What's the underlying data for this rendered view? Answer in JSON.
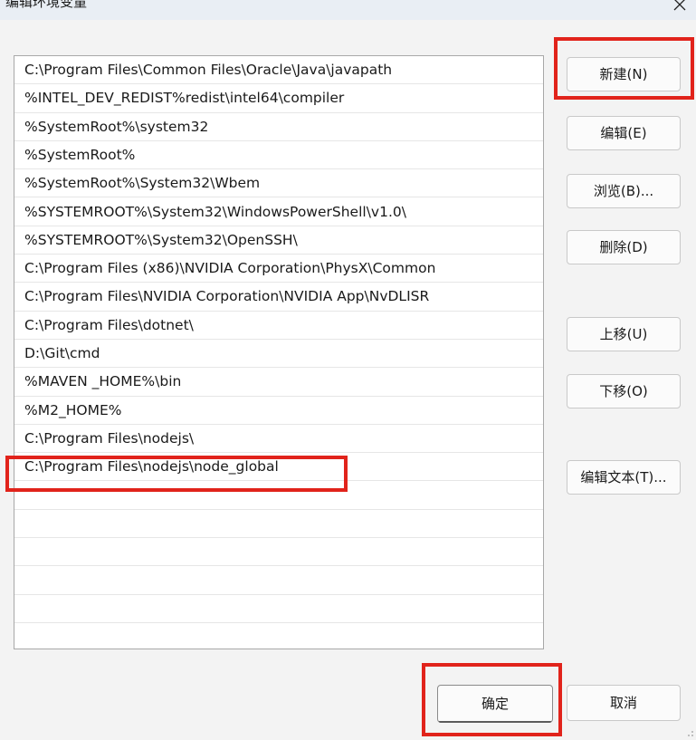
{
  "window": {
    "title": "编辑环境变量",
    "close_icon": "close-icon"
  },
  "path_list": {
    "entries": [
      "C:\\Program Files\\Common Files\\Oracle\\Java\\javapath",
      "%INTEL_DEV_REDIST%redist\\intel64\\compiler",
      "%SystemRoot%\\system32",
      "%SystemRoot%",
      "%SystemRoot%\\System32\\Wbem",
      "%SYSTEMROOT%\\System32\\WindowsPowerShell\\v1.0\\",
      "%SYSTEMROOT%\\System32\\OpenSSH\\",
      "C:\\Program Files (x86)\\NVIDIA Corporation\\PhysX\\Common",
      "C:\\Program Files\\NVIDIA Corporation\\NVIDIA App\\NvDLISR",
      "C:\\Program Files\\dotnet\\",
      "D:\\Git\\cmd",
      "%MAVEN _HOME%\\bin",
      "%M2_HOME%",
      "C:\\Program Files\\nodejs\\",
      "C:\\Program Files\\nodejs\\node_global",
      "",
      "",
      "",
      "",
      "",
      ""
    ]
  },
  "buttons": {
    "new": "新建(N)",
    "edit": "编辑(E)",
    "browse": "浏览(B)...",
    "delete": "删除(D)",
    "move_up": "上移(U)",
    "move_down": "下移(O)",
    "edit_text": "编辑文本(T)...",
    "ok": "确定",
    "cancel": "取消"
  },
  "annotation_color": "#e1231b"
}
